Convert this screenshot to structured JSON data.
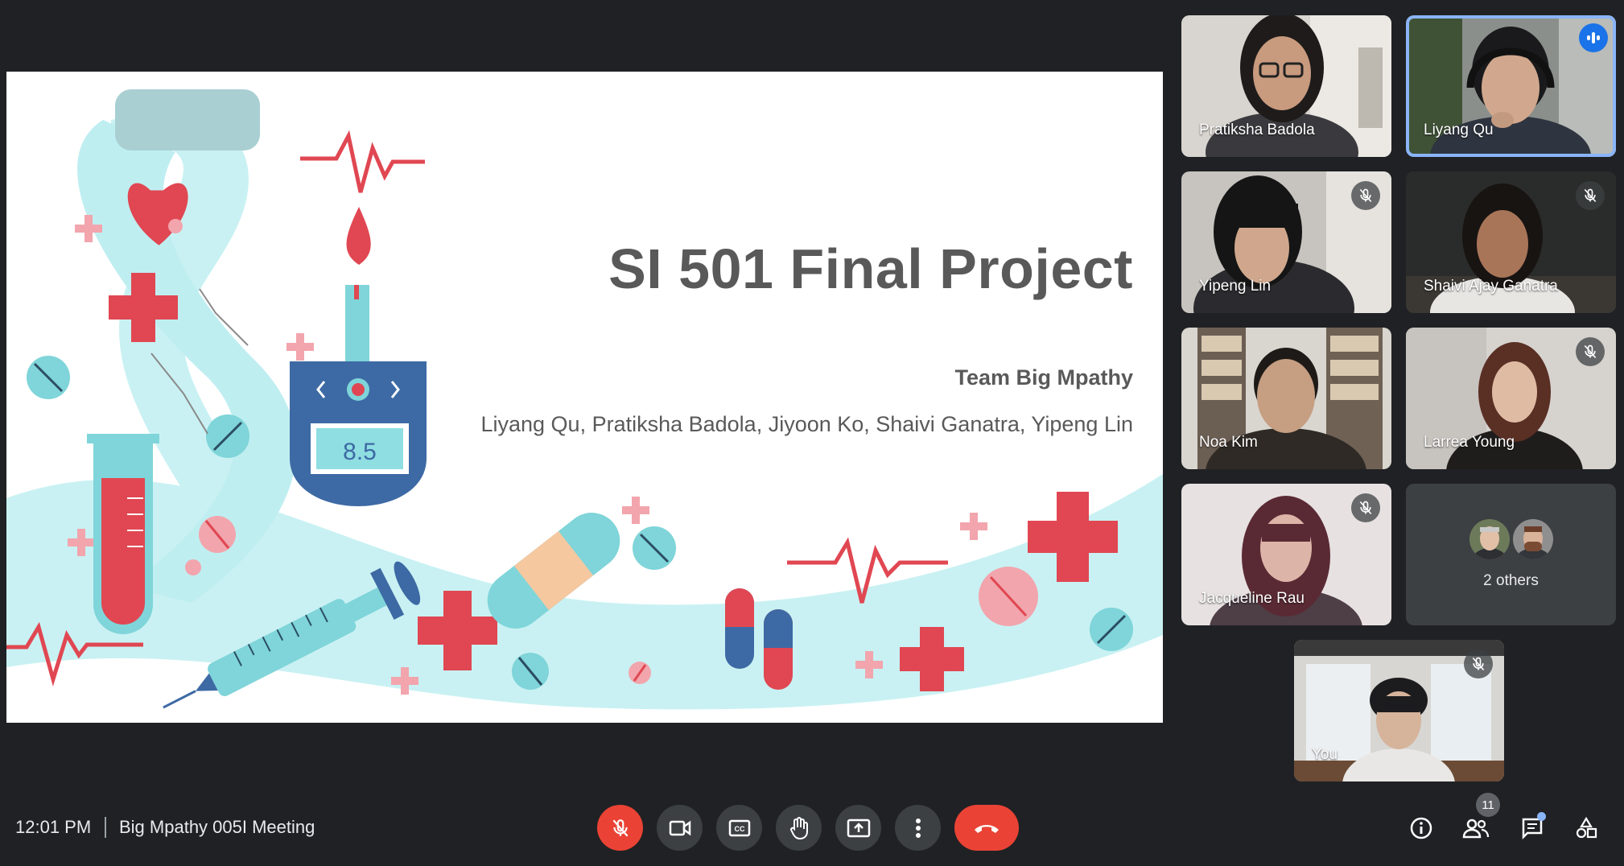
{
  "slide": {
    "title": "SI 501 Final Project",
    "team": "Team Big Mpathy",
    "members": "Liyang Qu, Pratiksha Badola, Jiyoon Ko, Shaivi Ganatra, Yipeng Lin",
    "meter_reading": "8.5"
  },
  "participants": [
    {
      "name": "Pratiksha Badola",
      "muted": false
    },
    {
      "name": "Liyang Qu",
      "muted": false,
      "speaking": true
    },
    {
      "name": "Yipeng Lin",
      "muted": true
    },
    {
      "name": "Shaivi Ajay Ganatra",
      "muted": true
    },
    {
      "name": "Noa Kim",
      "muted": false
    },
    {
      "name": "Larrea Young",
      "muted": true
    },
    {
      "name": "Jacqueline Rau",
      "muted": true
    }
  ],
  "others_label": "2 others",
  "self_label": "You",
  "bottom_bar": {
    "time": "12:01 PM",
    "meeting_name": "Big Mpathy 005I Meeting",
    "people_count": "11",
    "controls": [
      "mic-off-icon",
      "camera-icon",
      "captions-icon",
      "raise-hand-icon",
      "present-icon",
      "more-vert-icon",
      "call-end-icon"
    ],
    "right_controls": [
      "info-icon",
      "people-icon",
      "chat-icon",
      "activities-icon"
    ]
  },
  "colors": {
    "background": "#202124",
    "tile": "#3c4043",
    "danger": "#ea4335",
    "active_border": "#8ab4f8",
    "slide_text": "#595959",
    "slide_red": "#e04752",
    "slide_teal": "#7fd5d9",
    "slide_navy": "#3d6aa4"
  }
}
